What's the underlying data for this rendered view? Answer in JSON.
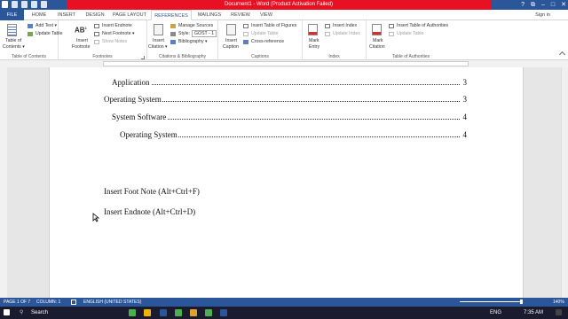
{
  "title_bar": {
    "text": "Document1 - Word (Product Activation Failed)",
    "help": "?",
    "restore_ribbon": "⧉",
    "minimize": "–",
    "maximize": "□",
    "close": "✕"
  },
  "tabs": {
    "file": "FILE",
    "home": "HOME",
    "insert": "INSERT",
    "design": "DESIGN",
    "page_layout": "PAGE LAYOUT",
    "references": "REFERENCES",
    "mailings": "MAILINGS",
    "review": "REVIEW",
    "view": "VIEW",
    "sign_in": "Sign in"
  },
  "ribbon": {
    "toc": {
      "table_of_contents": "Table of",
      "table_of_contents2": "Contents ▾",
      "add_text": "Add Text ▾",
      "update_table": "Update Table",
      "label": "Table of Contents"
    },
    "footnotes": {
      "insert_footnote": "Insert",
      "insert_footnote2": "Footnote",
      "insert_endnote": "Insert Endnote",
      "next_footnote": "Next Footnote ▾",
      "show_notes": "Show Notes",
      "label": "Footnotes",
      "ab_glyph": "AB",
      "ab_sup": "1"
    },
    "citations": {
      "insert_citation": "Insert",
      "insert_citation2": "Citation ▾",
      "manage_sources": "Manage Sources",
      "style_label": "Style:",
      "style_value": "GOST - 1",
      "bibliography": "Bibliography ▾",
      "label": "Citations & Bibliography"
    },
    "captions": {
      "insert_caption": "Insert",
      "insert_caption2": "Caption",
      "insert_table_of_figures": "Insert Table of Figures",
      "update_table": "Update Table",
      "cross_reference": "Cross-reference",
      "label": "Captions"
    },
    "index": {
      "mark_entry": "Mark",
      "mark_entry2": "Entry",
      "insert_index": "Insert Index",
      "update_index": "Update Index",
      "label": "Index"
    },
    "authorities": {
      "mark_citation": "Mark",
      "mark_citation2": "Citation",
      "insert_table_of_authorities": "Insert Table of Authorities",
      "update_table": "Update Table",
      "label": "Table of Authorities"
    }
  },
  "document": {
    "toc": [
      {
        "text": "Application",
        "page": "3"
      },
      {
        "text": "Operating System",
        "page": "3"
      },
      {
        "text": "System Software",
        "page": "4"
      },
      {
        "text": "Operating System",
        "page": "4"
      }
    ],
    "lines": [
      "Insert Foot Note (Alt+Ctrl+F)",
      "Insert Endnote (Alt+Ctrl+D)"
    ]
  },
  "status_bar": {
    "page": "PAGE 1 OF 7",
    "column": "COLUMN: 1",
    "language": "ENGLISH (UNITED STATES)",
    "zoom": "140%"
  },
  "taskbar": {
    "search": "Search",
    "language": "ENG",
    "time": "7:35 AM"
  }
}
